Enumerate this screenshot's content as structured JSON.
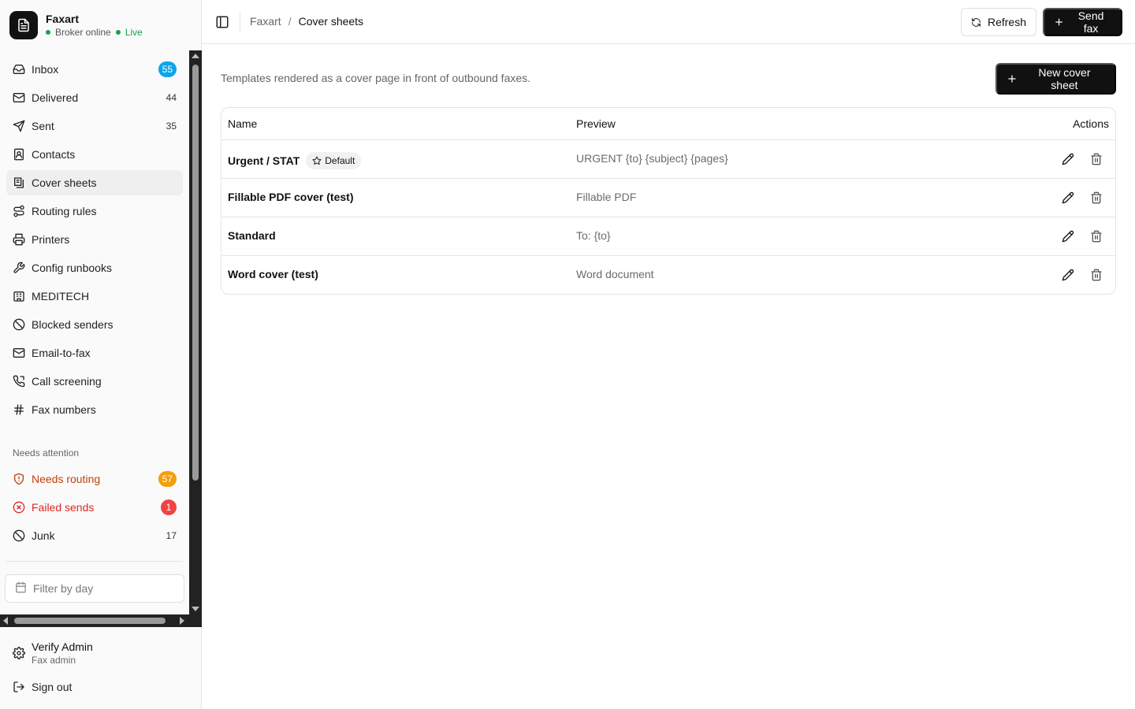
{
  "app": {
    "name": "Faxart",
    "status": "Broker online",
    "live": "Live"
  },
  "sidebar": {
    "items": [
      {
        "label": "Inbox",
        "badge": "55",
        "icon": "inbox-icon"
      },
      {
        "label": "Delivered",
        "count": "44",
        "icon": "mail-icon"
      },
      {
        "label": "Sent",
        "count": "35",
        "icon": "send-icon"
      },
      {
        "label": "Contacts",
        "icon": "contacts-icon"
      },
      {
        "label": "Cover sheets",
        "icon": "cover-sheets-icon",
        "active": true
      },
      {
        "label": "Routing rules",
        "icon": "route-icon"
      },
      {
        "label": "Printers",
        "icon": "printer-icon"
      },
      {
        "label": "Config runbooks",
        "icon": "wrench-icon"
      },
      {
        "label": "MEDITECH",
        "icon": "building-icon"
      },
      {
        "label": "Blocked senders",
        "icon": "ban-icon"
      },
      {
        "label": "Email-to-fax",
        "icon": "mail-icon"
      },
      {
        "label": "Call screening",
        "icon": "phone-icon"
      },
      {
        "label": "Fax numbers",
        "icon": "hash-icon"
      }
    ],
    "attention_title": "Needs attention",
    "attention": [
      {
        "label": "Needs routing",
        "badge": "57",
        "icon": "shield-alert-icon"
      },
      {
        "label": "Failed sends",
        "badge": "1",
        "icon": "x-circle-icon"
      },
      {
        "label": "Junk",
        "count": "17",
        "icon": "ban-icon"
      }
    ],
    "filter_placeholder": "Filter by day"
  },
  "user": {
    "name": "Verify Admin",
    "role": "Fax admin",
    "signout": "Sign out"
  },
  "topbar": {
    "breadcrumb_root": "Faxart",
    "breadcrumb_sep": "/",
    "breadcrumb_current": "Cover sheets",
    "refresh_label": "Refresh",
    "send_label": "Send fax"
  },
  "main": {
    "subtitle": "Templates rendered as a cover page in front of outbound faxes.",
    "new_label": "New cover sheet",
    "columns": {
      "name": "Name",
      "preview": "Preview",
      "actions": "Actions"
    },
    "rows": [
      {
        "name": "Urgent / STAT",
        "badge": "Default",
        "preview": "URGENT {to} {subject} {pages}"
      },
      {
        "name": "Fillable PDF cover (test)",
        "preview": "Fillable PDF"
      },
      {
        "name": "Standard",
        "preview": "To: {to}"
      },
      {
        "name": "Word cover (test)",
        "preview": "Word document"
      }
    ]
  },
  "colors": {
    "accent": "#111111",
    "live": "#16a34a",
    "info_badge": "#0ea5e9",
    "warning": "#f59e0b",
    "danger": "#ef4444"
  }
}
